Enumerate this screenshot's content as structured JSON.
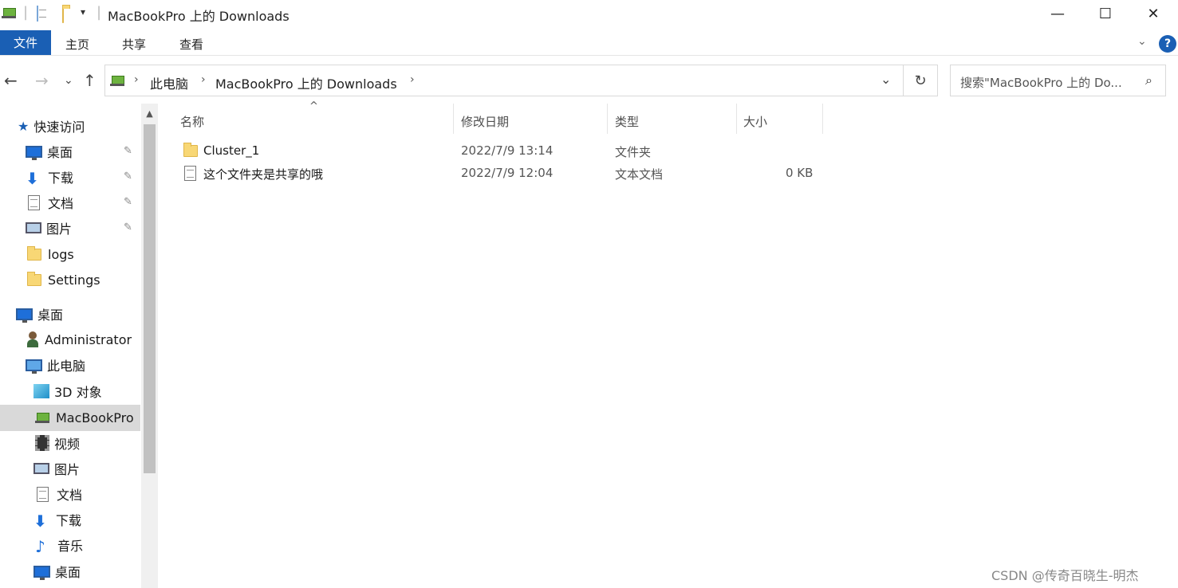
{
  "window": {
    "title": "MacBookPro 上的 Downloads",
    "minimize": "—",
    "maximize": "☐",
    "close": "✕"
  },
  "ribbon": {
    "tabs": [
      "文件",
      "主页",
      "共享",
      "查看"
    ],
    "help": "?",
    "collapse": "⌄"
  },
  "nav": {
    "back": "←",
    "forward": "→",
    "recent": "⌄",
    "up": "↑"
  },
  "address": {
    "crumbs": [
      "此电脑",
      "MacBookPro 上的 Downloads"
    ],
    "separator": "›",
    "dropdown": "⌄",
    "refresh": "↻"
  },
  "search": {
    "placeholder": "搜索\"MacBookPro 上的 Do...",
    "icon": "search-icon"
  },
  "sidebar": {
    "quick_access": {
      "label": "快速访问",
      "icon": "star-icon"
    },
    "quick_items": [
      {
        "label": "桌面",
        "icon": "desktop-icon",
        "pinned": true
      },
      {
        "label": "下载",
        "icon": "download-icon",
        "pinned": true
      },
      {
        "label": "文档",
        "icon": "document-icon",
        "pinned": true
      },
      {
        "label": "图片",
        "icon": "picture-icon",
        "pinned": true
      },
      {
        "label": "logs",
        "icon": "folder-icon",
        "pinned": false
      },
      {
        "label": "Settings",
        "icon": "folder-icon",
        "pinned": false
      }
    ],
    "desktop": {
      "label": "桌面",
      "icon": "desktop-icon"
    },
    "administrator": {
      "label": "Administrator",
      "icon": "user-icon"
    },
    "this_pc": {
      "label": "此电脑",
      "icon": "computer-icon"
    },
    "pc_items": [
      {
        "label": "3D 对象",
        "icon": "cube-icon"
      },
      {
        "label": "MacBookPro",
        "icon": "network-drive-icon",
        "selected": true
      },
      {
        "label": "视频",
        "icon": "video-icon"
      },
      {
        "label": "图片",
        "icon": "picture-icon"
      },
      {
        "label": "文档",
        "icon": "document-icon"
      },
      {
        "label": "下载",
        "icon": "download-icon"
      },
      {
        "label": "音乐",
        "icon": "music-icon"
      },
      {
        "label": "桌面",
        "icon": "desktop-icon"
      }
    ],
    "pin_glyph": "📌"
  },
  "columns": {
    "name": "名称",
    "modified": "修改日期",
    "type": "类型",
    "size": "大小",
    "sort_indicator": "^"
  },
  "files": [
    {
      "name": "Cluster_1",
      "modified": "2022/7/9 13:14",
      "type": "文件夹",
      "size": "",
      "icon": "folder-icon"
    },
    {
      "name": "这个文件夹是共享的哦",
      "modified": "2022/7/9 12:04",
      "type": "文本文档",
      "size": "0 KB",
      "icon": "text-file-icon"
    }
  ],
  "watermark": "CSDN @传奇百晓生-明杰",
  "colors": {
    "accent": "#1a5fb4",
    "selected": "#d9d9d9"
  }
}
